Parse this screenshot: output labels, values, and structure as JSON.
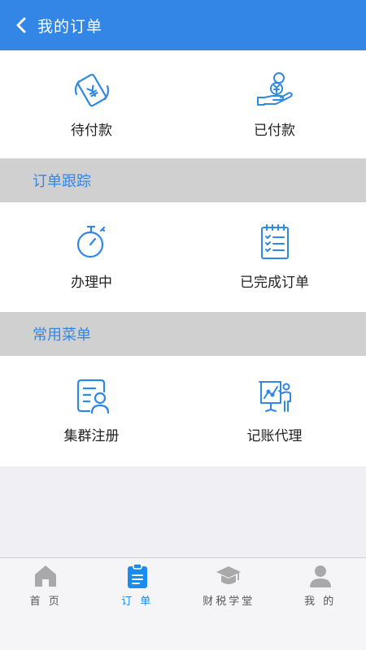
{
  "header": {
    "title": "我的订单",
    "back_icon": "chevron-left-icon"
  },
  "payment": {
    "items": [
      {
        "label": "待付款",
        "icon": "phone-payment-icon"
      },
      {
        "label": "已付款",
        "icon": "hand-coins-icon"
      }
    ]
  },
  "tracking": {
    "title": "订单跟踪",
    "items": [
      {
        "label": "办理中",
        "icon": "stopwatch-icon"
      },
      {
        "label": "已完成订单",
        "icon": "checklist-icon"
      }
    ]
  },
  "menu": {
    "title": "常用菜单",
    "items": [
      {
        "label": "集群注册",
        "icon": "id-card-icon"
      },
      {
        "label": "记账代理",
        "icon": "presentation-chart-icon"
      }
    ]
  },
  "tabbar": {
    "active": "订 单",
    "items": [
      {
        "label": "首 页",
        "icon": "home-icon"
      },
      {
        "label": "订 单",
        "icon": "clipboard-icon"
      },
      {
        "label": "财税学堂",
        "icon": "graduation-cap-icon"
      },
      {
        "label": "我 的",
        "icon": "user-icon"
      }
    ]
  },
  "colors": {
    "primary": "#3385e6",
    "section_bg": "#d0d0d0",
    "page_bg": "#efeff4",
    "tab_inactive": "#a9a9a9"
  }
}
